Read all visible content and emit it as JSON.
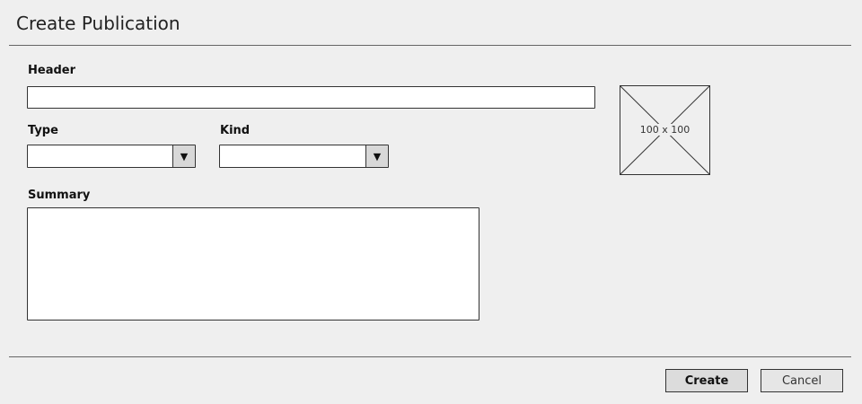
{
  "page": {
    "title": "Create Publication"
  },
  "form": {
    "header_label": "Header",
    "header_value": "",
    "type_label": "Type",
    "type_value": "",
    "kind_label": "Kind",
    "kind_value": "",
    "summary_label": "Summary",
    "summary_value": ""
  },
  "image_placeholder": {
    "size_text": "100 x 100"
  },
  "actions": {
    "create_label": "Create",
    "cancel_label": "Cancel"
  },
  "icons": {
    "dropdown": "chevron-down-icon",
    "image": "image-placeholder-icon"
  }
}
